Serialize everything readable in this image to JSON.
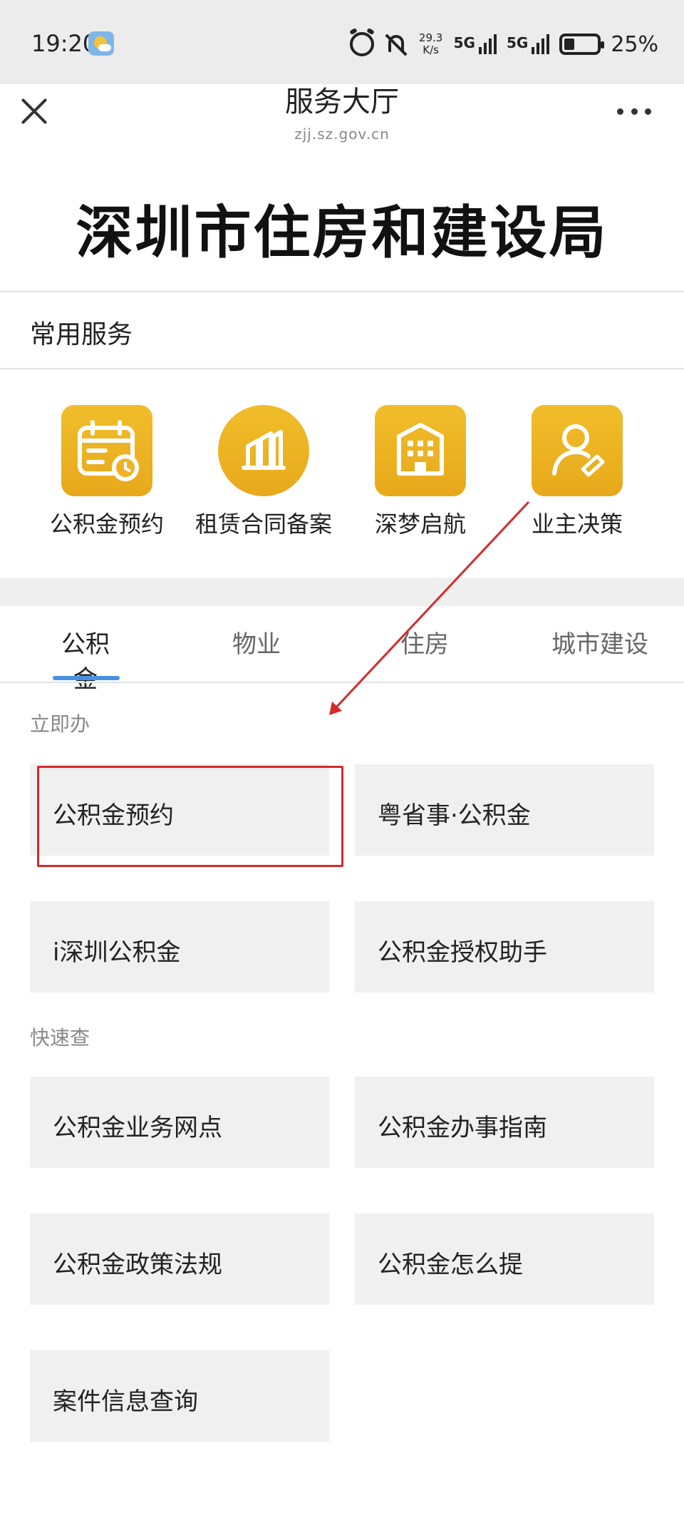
{
  "status_bar": {
    "time": "19:20",
    "net_speed_value": "29.3",
    "net_speed_unit": "K/s",
    "network_1": "5G",
    "network_2": "5G",
    "battery": "25%"
  },
  "nav": {
    "title": "服务大厅",
    "domain": "zjj.sz.gov.cn"
  },
  "header": {
    "org_name": "深圳市住房和建设局"
  },
  "common_services": {
    "label": "常用服务",
    "items": [
      {
        "label": "公积金预约",
        "icon": "calendar-icon"
      },
      {
        "label": "租赁合同备案",
        "icon": "building-chart-icon"
      },
      {
        "label": "深梦启航",
        "icon": "apartment-icon"
      },
      {
        "label": "业主决策",
        "icon": "user-ticket-icon"
      }
    ]
  },
  "tabs": [
    {
      "label": "公积金",
      "active": true
    },
    {
      "label": "物业",
      "active": false
    },
    {
      "label": "住房",
      "active": false
    },
    {
      "label": "城市建设",
      "active": false
    }
  ],
  "groups": {
    "immediate": {
      "label": "立即办",
      "items": [
        "公积金预约",
        "粤省事·公积金",
        "i深圳公积金",
        "公积金授权助手"
      ]
    },
    "quick_check": {
      "label": "快速查",
      "items": [
        "公积金业务网点",
        "公积金办事指南",
        "公积金政策法规",
        "公积金怎么提",
        "案件信息查询"
      ]
    }
  },
  "colors": {
    "accent_tab": "#4a90e2",
    "icon_gold": "#eeb325",
    "annotation_red": "#d42a2a"
  }
}
